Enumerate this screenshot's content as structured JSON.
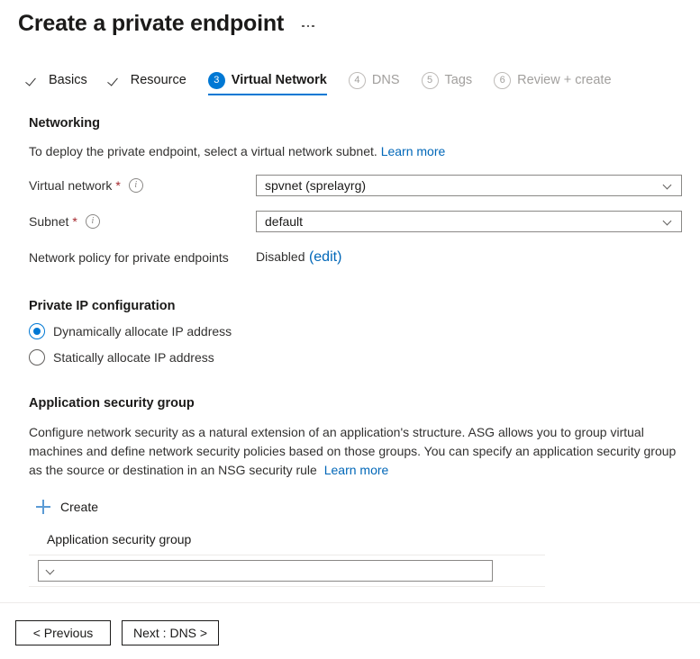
{
  "header": {
    "title": "Create a private endpoint",
    "more_menu": "…"
  },
  "wizard": {
    "tabs": [
      {
        "label": "Basics",
        "state": "done",
        "marker": "check"
      },
      {
        "label": "Resource",
        "state": "done",
        "marker": "check"
      },
      {
        "label": "Virtual Network",
        "state": "active",
        "marker": "3"
      },
      {
        "label": "DNS",
        "state": "disabled",
        "marker": "4"
      },
      {
        "label": "Tags",
        "state": "disabled",
        "marker": "5"
      },
      {
        "label": "Review + create",
        "state": "disabled",
        "marker": "6"
      }
    ]
  },
  "networking": {
    "heading": "Networking",
    "description": "To deploy the private endpoint, select a virtual network subnet.",
    "learn_more": "Learn more",
    "virtual_network": {
      "label": "Virtual network",
      "required_marker": "*",
      "info_icon": "info-icon",
      "value": "spvnet (sprelayrg)"
    },
    "subnet": {
      "label": "Subnet",
      "required_marker": "*",
      "info_icon": "info-icon",
      "value": "default"
    },
    "network_policy": {
      "label": "Network policy for private endpoints",
      "value": "Disabled",
      "edit_link": "(edit)"
    }
  },
  "private_ip": {
    "heading": "Private IP configuration",
    "options": [
      {
        "label": "Dynamically allocate IP address",
        "selected": true
      },
      {
        "label": "Statically allocate IP address",
        "selected": false
      }
    ]
  },
  "asg": {
    "heading": "Application security group",
    "description": "Configure network security as a natural extension of an application's structure. ASG allows you to group virtual machines and define network security policies based on those groups. You can specify an application security group as the source or destination in an NSG security rule",
    "learn_more": "Learn more",
    "create_label": "Create",
    "create_icon": "plus-icon",
    "field_label": "Application security group",
    "field_value": "",
    "field_placeholder": ""
  },
  "footer": {
    "previous_label": "< Previous",
    "next_label": "Next : DNS >"
  },
  "colors": {
    "accent": "#0078d4",
    "link": "#0067b8",
    "required": "#a4262c",
    "disabled_text": "#a19f9d",
    "plus_icon": "#5b9bd5"
  }
}
